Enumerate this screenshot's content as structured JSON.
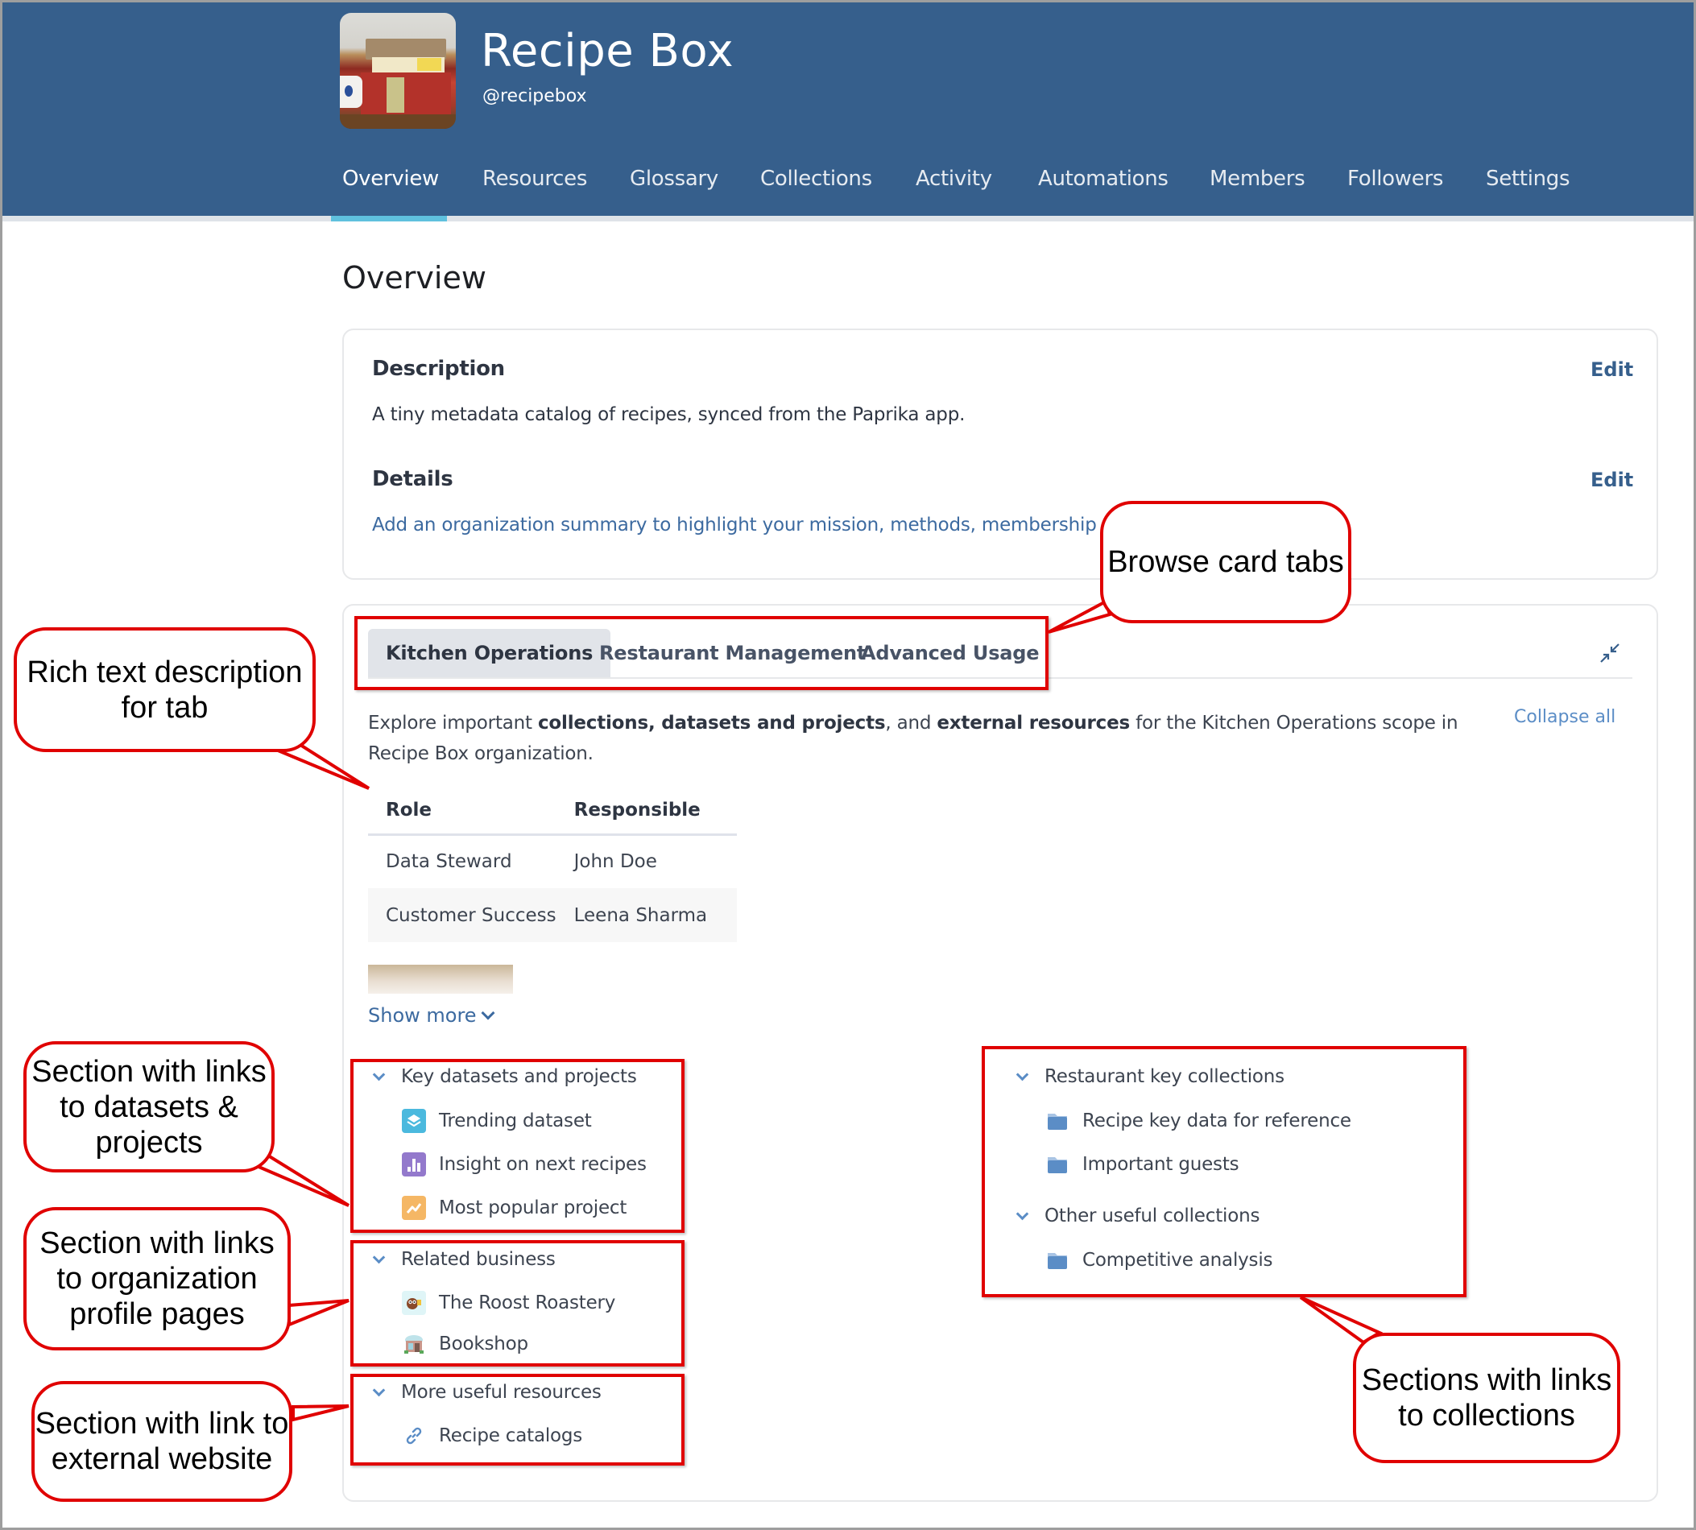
{
  "header": {
    "org_name": "Recipe Box",
    "org_handle": "@recipebox",
    "logo_icon": "recipe-box-photo",
    "brand_color": "#365f8c",
    "active_tab_color": "#5fc1de"
  },
  "nav": {
    "items": [
      {
        "label": "Overview",
        "active": true
      },
      {
        "label": "Resources",
        "active": false
      },
      {
        "label": "Glossary",
        "active": false
      },
      {
        "label": "Collections",
        "active": false
      },
      {
        "label": "Activity",
        "active": false
      },
      {
        "label": "Automations",
        "active": false
      },
      {
        "label": "Members",
        "active": false
      },
      {
        "label": "Followers",
        "active": false
      },
      {
        "label": "Settings",
        "active": false
      }
    ]
  },
  "page": {
    "title": "Overview"
  },
  "about_card": {
    "description": {
      "heading": "Description",
      "edit_label": "Edit",
      "text": "A tiny metadata catalog of recipes, synced from the Paprika app."
    },
    "details": {
      "heading": "Details",
      "edit_label": "Edit",
      "placeholder_link": "Add an organization summary to highlight your mission, methods, membership a"
    }
  },
  "browse_card": {
    "tabs": [
      {
        "label": "Kitchen Operations",
        "active": true
      },
      {
        "label": "Restaurant Management",
        "active": false
      },
      {
        "label": "Advanced Usage",
        "active": false
      }
    ],
    "collapse_icon": "collapse-arrows-icon",
    "collapse_all_label": "Collapse all",
    "rich_text": {
      "p1": "Explore important ",
      "b1": "collections, datasets and projects",
      "p2": ", and ",
      "b2": "external resources",
      "p3": " for the Kitchen Operations scope in Recipe Box organization."
    },
    "table": {
      "headers": [
        "Role",
        "Responsible"
      ],
      "rows": [
        [
          "Data Steward",
          "John Doe"
        ],
        [
          "Customer Success",
          "Leena Sharma"
        ]
      ]
    },
    "show_more_label": "Show more",
    "left_sections": [
      {
        "title": "Key datasets and projects",
        "items": [
          {
            "label": "Trending dataset",
            "icon": "dataset-icon"
          },
          {
            "label": "Insight on next recipes",
            "icon": "insight-icon"
          },
          {
            "label": "Most popular project",
            "icon": "project-icon"
          }
        ]
      },
      {
        "title": "Related business",
        "items": [
          {
            "label": "The Roost Roastery",
            "icon": "org-avatar-icon"
          },
          {
            "label": "Bookshop",
            "icon": "org-avatar-icon"
          }
        ]
      },
      {
        "title": "More useful resources",
        "items": [
          {
            "label": "Recipe catalogs",
            "icon": "link-icon"
          }
        ]
      }
    ],
    "right_sections": [
      {
        "title": "Restaurant key collections",
        "items": [
          {
            "label": "Recipe key data for reference",
            "icon": "folder-icon"
          },
          {
            "label": "Important guests",
            "icon": "folder-icon"
          }
        ]
      },
      {
        "title": "Other useful collections",
        "items": [
          {
            "label": "Competitive analysis",
            "icon": "folder-icon"
          }
        ]
      }
    ]
  },
  "annotations": {
    "color": "#e00000",
    "browse_tabs": "Browse card tabs",
    "rich_text": "Rich text description for tab",
    "datasets_section": "Section with links to datasets & projects",
    "org_section": "Section with links to organization profile pages",
    "external_section": "Section with link to external website",
    "collections_section": "Sections with links to collections"
  }
}
